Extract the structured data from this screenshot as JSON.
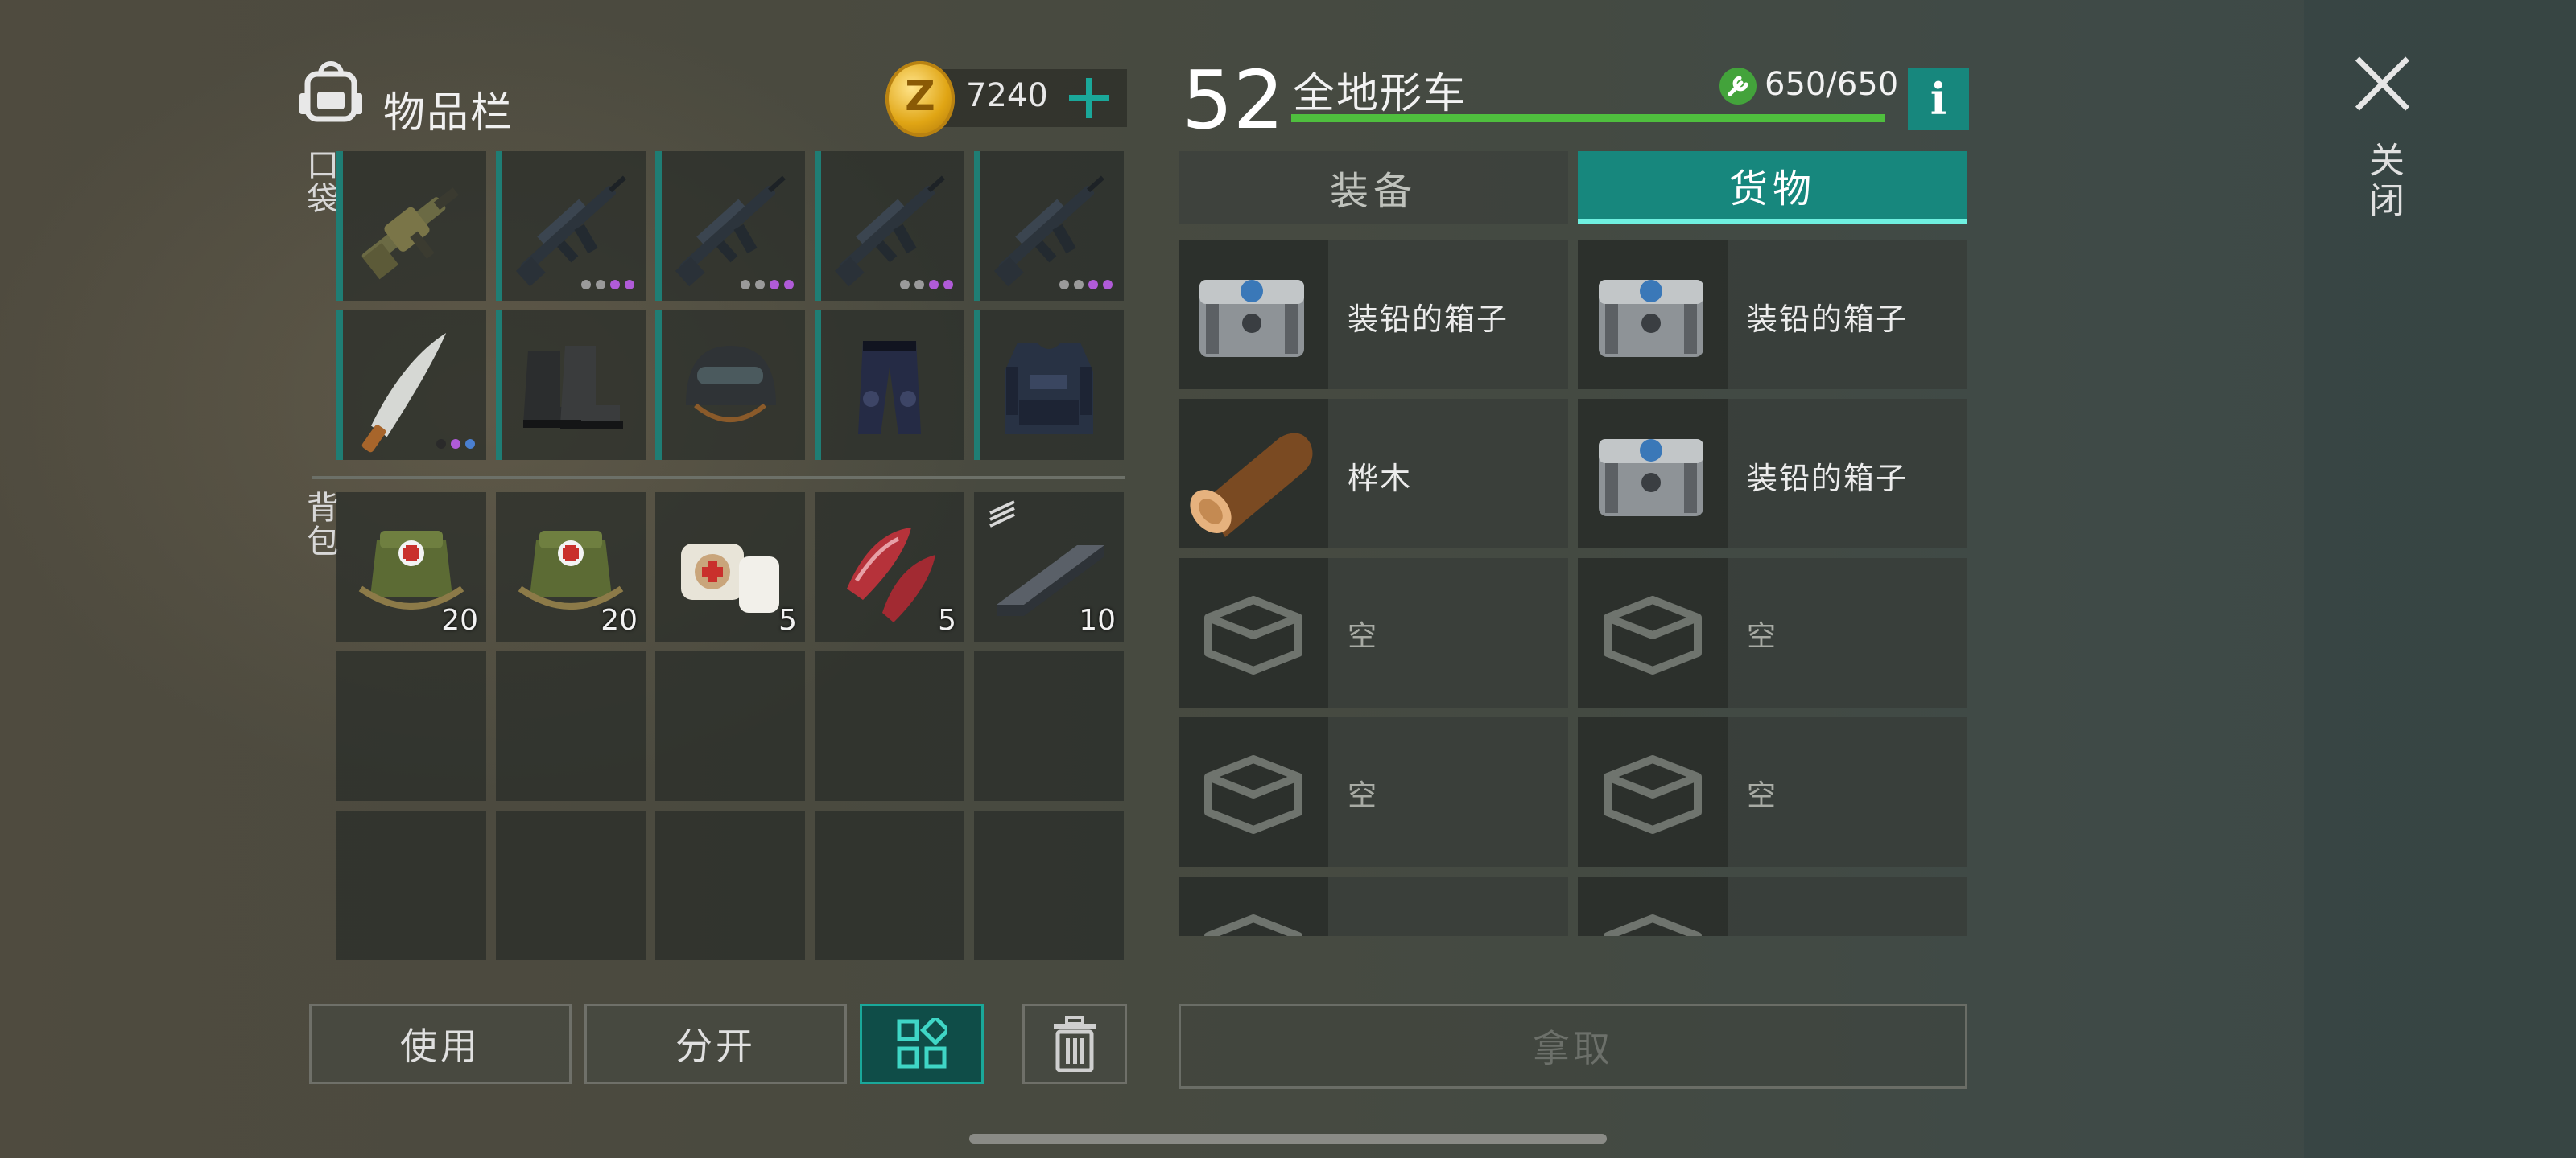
{
  "inventory": {
    "title": "物品栏",
    "coins": "7240",
    "coin_letter": "Z",
    "pockets_label": "口袋",
    "backpack_label": "背包",
    "pockets": [
      {
        "name": "grenade-launcher",
        "dots": []
      },
      {
        "name": "assault-rifle",
        "dots": [
          "#9a9a9a",
          "#9a9a9a",
          "#b05bd8",
          "#b05bd8"
        ]
      },
      {
        "name": "assault-rifle",
        "dots": [
          "#9a9a9a",
          "#9a9a9a",
          "#b05bd8",
          "#b05bd8"
        ]
      },
      {
        "name": "assault-rifle",
        "dots": [
          "#9a9a9a",
          "#9a9a9a",
          "#b05bd8",
          "#b05bd8"
        ]
      },
      {
        "name": "assault-rifle",
        "dots": [
          "#9a9a9a",
          "#9a9a9a",
          "#b05bd8",
          "#b05bd8"
        ]
      },
      {
        "name": "machete",
        "dots": [
          "#2a2a2a",
          "#b05bd8",
          "#4a7fd0"
        ]
      },
      {
        "name": "boots",
        "dots": []
      },
      {
        "name": "helmet",
        "dots": []
      },
      {
        "name": "pants",
        "dots": []
      },
      {
        "name": "vest",
        "dots": []
      }
    ],
    "backpack": [
      {
        "name": "medkit",
        "count": "20"
      },
      {
        "name": "medkit",
        "count": "20"
      },
      {
        "name": "bandage",
        "count": "5"
      },
      {
        "name": "raw-meat",
        "count": "5"
      },
      {
        "name": "iron-bar",
        "count": "10"
      }
    ],
    "buttons": {
      "use": "使用",
      "split": "分开"
    }
  },
  "vehicle": {
    "level": "52",
    "name": "全地形车",
    "durability": "650/650",
    "durability_fraction": 1.0,
    "info_label": "i",
    "tabs": {
      "equipment": "装备",
      "cargo": "货物"
    },
    "active_tab": "cargo",
    "cargo": [
      {
        "label": "装铅的箱子",
        "icon": "lead-box"
      },
      {
        "label": "装铅的箱子",
        "icon": "lead-box"
      },
      {
        "label": "桦木",
        "icon": "birch-log"
      },
      {
        "label": "装铅的箱子",
        "icon": "lead-box"
      },
      {
        "label": "空",
        "icon": "empty-slot"
      },
      {
        "label": "空",
        "icon": "empty-slot"
      },
      {
        "label": "空",
        "icon": "empty-slot"
      },
      {
        "label": "空",
        "icon": "empty-slot"
      }
    ],
    "take_label": "拿取"
  },
  "close_label": "关闭",
  "colors": {
    "accent": "#17877d",
    "durability": "#4fbf3e",
    "coin": "#e0a514"
  }
}
